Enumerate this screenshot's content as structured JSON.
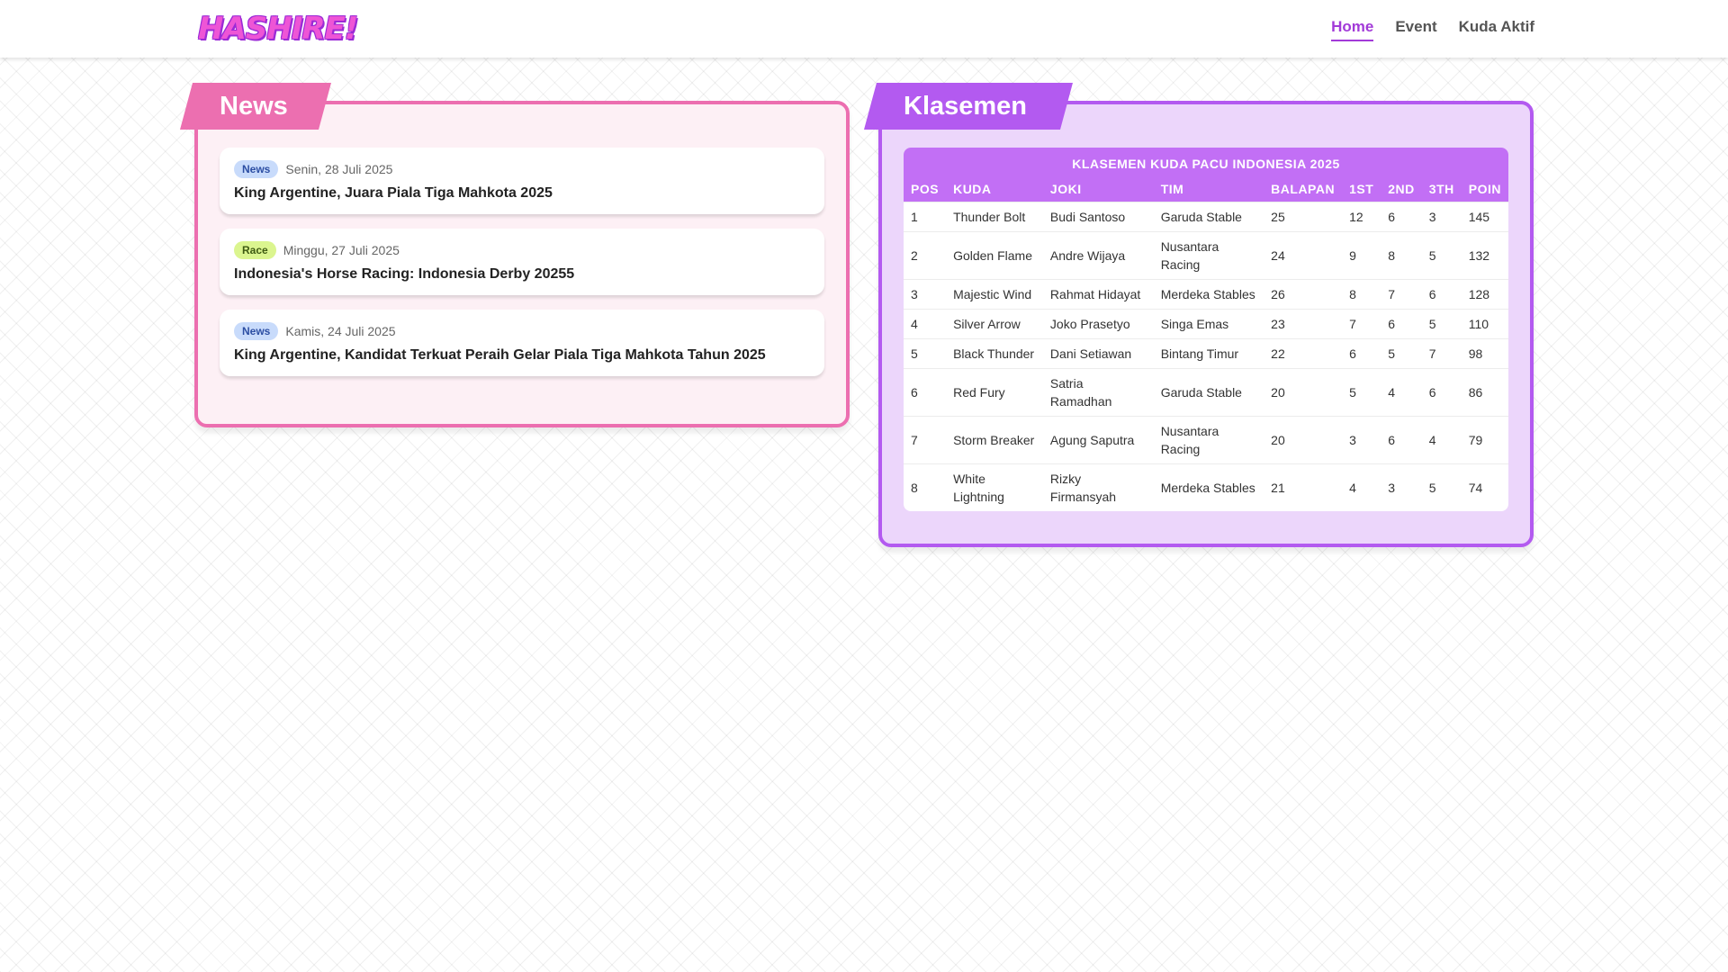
{
  "brand": {
    "logo_text": "HASHIRE!"
  },
  "nav": [
    {
      "label": "Home",
      "active": true
    },
    {
      "label": "Event",
      "active": false
    },
    {
      "label": "Kuda Aktif",
      "active": false
    }
  ],
  "news": {
    "title": "News",
    "items": [
      {
        "badge": "News",
        "date": "Senin, 28 Juli 2025",
        "title": "King Argentine, Juara Piala Tiga Mahkota 2025"
      },
      {
        "badge": "Race",
        "date": "Minggu, 27 Juli 2025",
        "title": "Indonesia's Horse Racing: Indonesia Derby 20255"
      },
      {
        "badge": "News",
        "date": "Kamis, 24 Juli 2025",
        "title": "King Argentine, Kandidat Terkuat Peraih Gelar Piala Tiga Mahkota Tahun 2025"
      }
    ]
  },
  "klasemen": {
    "title": "Klasemen",
    "caption": "KLASEMEN KUDA PACU INDONESIA 2025",
    "columns": [
      "POS",
      "KUDA",
      "JOKI",
      "TIM",
      "BALAPAN",
      "1ST",
      "2ND",
      "3TH",
      "POIN"
    ],
    "rows": [
      [
        "1",
        "Thunder Bolt",
        "Budi Santoso",
        "Garuda Stable",
        "25",
        "12",
        "6",
        "3",
        "145"
      ],
      [
        "2",
        "Golden Flame",
        "Andre Wijaya",
        "Nusantara Racing",
        "24",
        "9",
        "8",
        "5",
        "132"
      ],
      [
        "3",
        "Majestic Wind",
        "Rahmat Hidayat",
        "Merdeka Stables",
        "26",
        "8",
        "7",
        "6",
        "128"
      ],
      [
        "4",
        "Silver Arrow",
        "Joko Prasetyo",
        "Singa Emas",
        "23",
        "7",
        "6",
        "5",
        "110"
      ],
      [
        "5",
        "Black Thunder",
        "Dani Setiawan",
        "Bintang Timur",
        "22",
        "6",
        "5",
        "7",
        "98"
      ],
      [
        "6",
        "Red Fury",
        "Satria Ramadhan",
        "Garuda Stable",
        "20",
        "5",
        "4",
        "6",
        "86"
      ],
      [
        "7",
        "Storm Breaker",
        "Agung Saputra",
        "Nusantara Racing",
        "20",
        "3",
        "6",
        "4",
        "79"
      ],
      [
        "8",
        "White Lightning",
        "Rizky Firmansyah",
        "Merdeka Stables",
        "21",
        "4",
        "3",
        "5",
        "74"
      ]
    ]
  },
  "colors": {
    "accent": "#a23ad8",
    "news_border": "#ec6fb0",
    "klasemen_border": "#b35af0"
  }
}
